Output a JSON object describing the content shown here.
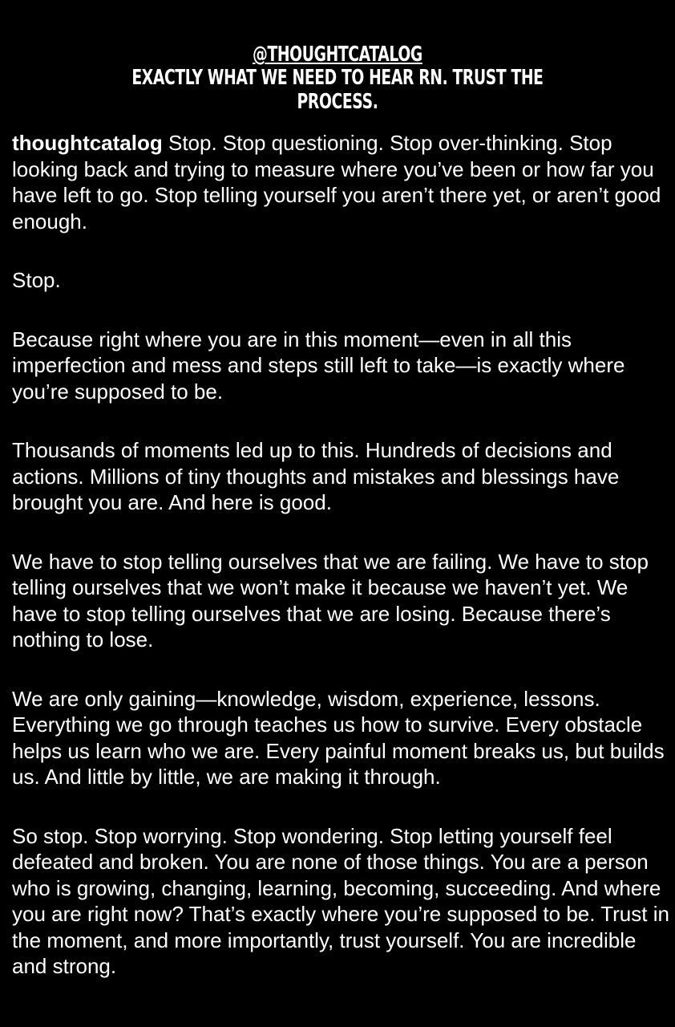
{
  "header": {
    "handle": "@THOUGHTCATALOG",
    "caption": "EXACTLY WHAT WE NEED TO HEAR RN. TRUST THE PROCESS."
  },
  "post": {
    "username": "thoughtcatalog",
    "paragraphs": [
      " Stop. Stop questioning. Stop over-thinking. Stop looking back and trying to measure where you’ve been or how far you have left to go. Stop telling yourself you aren’t there yet, or aren’t good enough.",
      "Stop.",
      "Because right where you are in this moment—even in all this imperfection and mess and steps still left to take—is exactly where you’re supposed to be.",
      "Thousands of moments led up to this. Hundreds of decisions and actions. Millions of tiny thoughts and mistakes and blessings have brought you are. And here is good.",
      "We have to stop telling ourselves that we are failing. We have to stop telling ourselves that we won’t make it because we haven’t yet. We have to stop telling ourselves that we are losing. Because there’s nothing to lose.",
      "We are only gaining—knowledge, wisdom, experience, lessons. Everything we go through teaches us how to survive. Every obstacle helps us learn who we are. Every painful moment breaks us, but builds us. And little by little, we are making it through.",
      "So stop. Stop worrying. Stop wondering. Stop letting yourself feel defeated and broken. You are none of those things. You are a person who is growing, changing, learning, becoming, succeeding. And where you are right now? That’s exactly where you’re supposed to be. Trust in the moment, and more importantly, trust yourself. You are incredible and strong."
    ]
  },
  "colors": {
    "background": "#000000",
    "text": "#ffffff"
  }
}
